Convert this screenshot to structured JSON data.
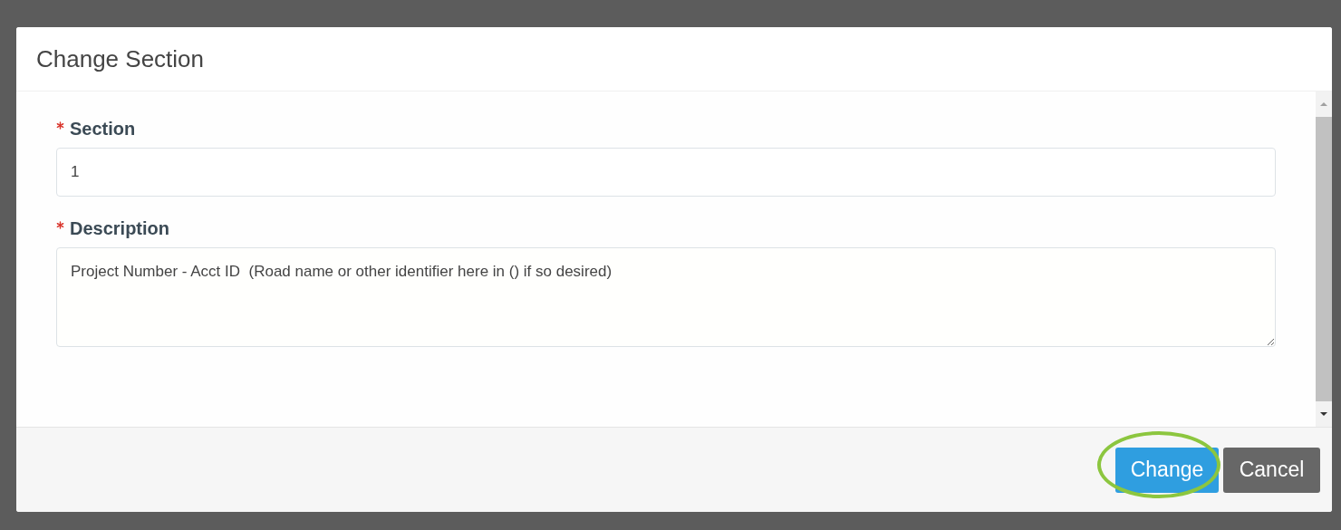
{
  "dialog": {
    "title": "Change Section"
  },
  "fields": [
    {
      "kind": "input",
      "label": "Section",
      "required": true,
      "value": "1"
    },
    {
      "kind": "textarea",
      "label": "Description",
      "required": true,
      "value": "Project Number - Acct ID  (Road name or other identifier here in () if so desired)"
    }
  ],
  "buttons": [
    {
      "label": "Change",
      "kind": "primary",
      "highlighted": true
    },
    {
      "label": "Cancel",
      "kind": "secondary",
      "highlighted": false
    }
  ]
}
